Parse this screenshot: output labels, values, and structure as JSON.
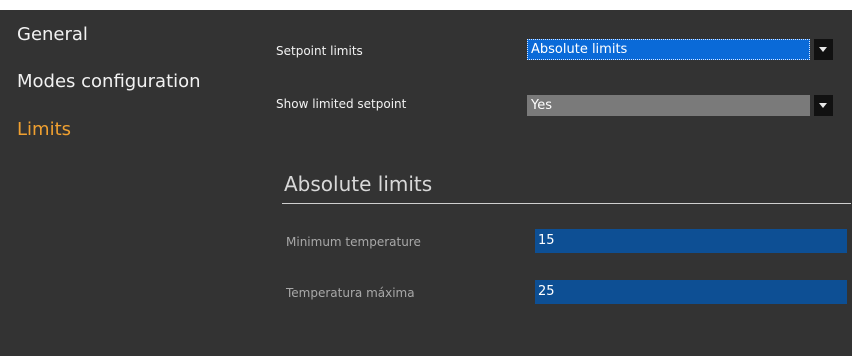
{
  "sidebar": {
    "items": [
      {
        "label": "General"
      },
      {
        "label": "Modes configuration"
      },
      {
        "label": "Limits"
      }
    ],
    "active_color": "#f0a030"
  },
  "form": {
    "setpoint_limits": {
      "label": "Setpoint limits",
      "value": "Absolute limits"
    },
    "show_limited_setpoint": {
      "label": "Show limited setpoint",
      "value": "Yes"
    }
  },
  "section": {
    "title": "Absolute limits",
    "min_temperature": {
      "label": "Minimum temperature",
      "value": "15"
    },
    "max_temperature": {
      "label": "Temperatura máxima",
      "value": "25"
    }
  },
  "colors": {
    "background": "#333333",
    "select_focused": "#0a6ad8",
    "select_plain": "#7a7a7a",
    "input_fill": "#0d4f94"
  },
  "icons": {
    "dropdown": "chevron-down-icon"
  }
}
